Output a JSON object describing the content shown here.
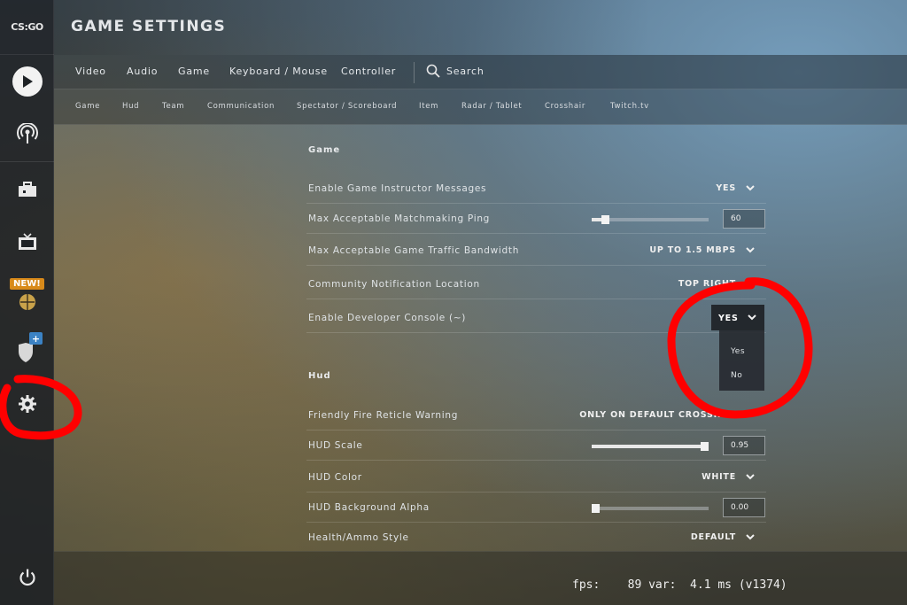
{
  "app": {
    "logo_text": "CS:GO",
    "title": "GAME SETTINGS"
  },
  "sidebar": {
    "items": [
      {
        "name": "play",
        "icon": "play-icon"
      },
      {
        "name": "watch",
        "icon": "broadcast-icon"
      },
      {
        "name": "inventory",
        "icon": "briefcase-icon"
      },
      {
        "name": "tv",
        "icon": "tv-icon"
      },
      {
        "name": "operation",
        "icon": "globe-icon",
        "badge": "NEW!"
      },
      {
        "name": "shield",
        "icon": "shield-icon",
        "badge": "+"
      },
      {
        "name": "settings",
        "icon": "gear-icon"
      },
      {
        "name": "power",
        "icon": "power-icon"
      }
    ]
  },
  "main_tabs": {
    "items": [
      "Video",
      "Audio",
      "Game",
      "Keyboard / Mouse",
      "Controller"
    ],
    "search_label": "Search"
  },
  "sub_tabs": {
    "items": [
      "Game",
      "Hud",
      "Team",
      "Communication",
      "Spectator / Scoreboard",
      "Item",
      "Radar / Tablet",
      "Crosshair",
      "Twitch.tv"
    ]
  },
  "sections": {
    "game": {
      "title": "Game",
      "rows": [
        {
          "label": "Enable Game Instructor Messages",
          "value": "YES"
        },
        {
          "label": "Max Acceptable Matchmaking Ping",
          "value": "60",
          "slider_fraction": 0.08
        },
        {
          "label": "Max Acceptable Game Traffic Bandwidth",
          "value": "UP TO 1.5 MBPS"
        },
        {
          "label": "Community Notification Location",
          "value": "TOP RIGHT"
        },
        {
          "label": "Enable Developer Console (~)",
          "value": "YES",
          "options": [
            "Yes",
            "No"
          ]
        }
      ]
    },
    "hud": {
      "title": "Hud",
      "rows": [
        {
          "label": "Friendly Fire Reticle Warning",
          "value": "ONLY ON DEFAULT CROSSHAIR"
        },
        {
          "label": "HUD Scale",
          "value": "0.95",
          "slider_fraction": 0.95
        },
        {
          "label": "HUD Color",
          "value": "WHITE"
        },
        {
          "label": "HUD Background Alpha",
          "value": "0.00",
          "slider_fraction": 0.0
        },
        {
          "label": "Health/Ammo Style",
          "value": "DEFAULT"
        }
      ]
    }
  },
  "fps_overlay": "fps:    89 var:  4.1 ms (v1374)",
  "colors": {
    "annotation": "#ff0000",
    "new_badge": "#d88a1a",
    "plus_badge": "#3b82c4"
  }
}
